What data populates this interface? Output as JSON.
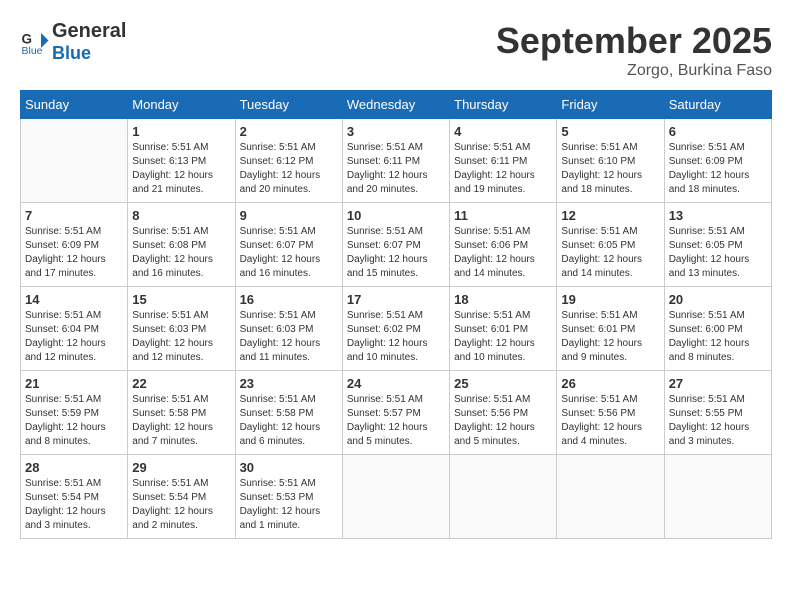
{
  "header": {
    "logo_line1": "General",
    "logo_line2": "Blue",
    "month": "September 2025",
    "location": "Zorgo, Burkina Faso"
  },
  "days_of_week": [
    "Sunday",
    "Monday",
    "Tuesday",
    "Wednesday",
    "Thursday",
    "Friday",
    "Saturday"
  ],
  "weeks": [
    [
      {
        "day": "",
        "info": ""
      },
      {
        "day": "1",
        "info": "Sunrise: 5:51 AM\nSunset: 6:13 PM\nDaylight: 12 hours\nand 21 minutes."
      },
      {
        "day": "2",
        "info": "Sunrise: 5:51 AM\nSunset: 6:12 PM\nDaylight: 12 hours\nand 20 minutes."
      },
      {
        "day": "3",
        "info": "Sunrise: 5:51 AM\nSunset: 6:11 PM\nDaylight: 12 hours\nand 20 minutes."
      },
      {
        "day": "4",
        "info": "Sunrise: 5:51 AM\nSunset: 6:11 PM\nDaylight: 12 hours\nand 19 minutes."
      },
      {
        "day": "5",
        "info": "Sunrise: 5:51 AM\nSunset: 6:10 PM\nDaylight: 12 hours\nand 18 minutes."
      },
      {
        "day": "6",
        "info": "Sunrise: 5:51 AM\nSunset: 6:09 PM\nDaylight: 12 hours\nand 18 minutes."
      }
    ],
    [
      {
        "day": "7",
        "info": "Sunrise: 5:51 AM\nSunset: 6:09 PM\nDaylight: 12 hours\nand 17 minutes."
      },
      {
        "day": "8",
        "info": "Sunrise: 5:51 AM\nSunset: 6:08 PM\nDaylight: 12 hours\nand 16 minutes."
      },
      {
        "day": "9",
        "info": "Sunrise: 5:51 AM\nSunset: 6:07 PM\nDaylight: 12 hours\nand 16 minutes."
      },
      {
        "day": "10",
        "info": "Sunrise: 5:51 AM\nSunset: 6:07 PM\nDaylight: 12 hours\nand 15 minutes."
      },
      {
        "day": "11",
        "info": "Sunrise: 5:51 AM\nSunset: 6:06 PM\nDaylight: 12 hours\nand 14 minutes."
      },
      {
        "day": "12",
        "info": "Sunrise: 5:51 AM\nSunset: 6:05 PM\nDaylight: 12 hours\nand 14 minutes."
      },
      {
        "day": "13",
        "info": "Sunrise: 5:51 AM\nSunset: 6:05 PM\nDaylight: 12 hours\nand 13 minutes."
      }
    ],
    [
      {
        "day": "14",
        "info": "Sunrise: 5:51 AM\nSunset: 6:04 PM\nDaylight: 12 hours\nand 12 minutes."
      },
      {
        "day": "15",
        "info": "Sunrise: 5:51 AM\nSunset: 6:03 PM\nDaylight: 12 hours\nand 12 minutes."
      },
      {
        "day": "16",
        "info": "Sunrise: 5:51 AM\nSunset: 6:03 PM\nDaylight: 12 hours\nand 11 minutes."
      },
      {
        "day": "17",
        "info": "Sunrise: 5:51 AM\nSunset: 6:02 PM\nDaylight: 12 hours\nand 10 minutes."
      },
      {
        "day": "18",
        "info": "Sunrise: 5:51 AM\nSunset: 6:01 PM\nDaylight: 12 hours\nand 10 minutes."
      },
      {
        "day": "19",
        "info": "Sunrise: 5:51 AM\nSunset: 6:01 PM\nDaylight: 12 hours\nand 9 minutes."
      },
      {
        "day": "20",
        "info": "Sunrise: 5:51 AM\nSunset: 6:00 PM\nDaylight: 12 hours\nand 8 minutes."
      }
    ],
    [
      {
        "day": "21",
        "info": "Sunrise: 5:51 AM\nSunset: 5:59 PM\nDaylight: 12 hours\nand 8 minutes."
      },
      {
        "day": "22",
        "info": "Sunrise: 5:51 AM\nSunset: 5:58 PM\nDaylight: 12 hours\nand 7 minutes."
      },
      {
        "day": "23",
        "info": "Sunrise: 5:51 AM\nSunset: 5:58 PM\nDaylight: 12 hours\nand 6 minutes."
      },
      {
        "day": "24",
        "info": "Sunrise: 5:51 AM\nSunset: 5:57 PM\nDaylight: 12 hours\nand 5 minutes."
      },
      {
        "day": "25",
        "info": "Sunrise: 5:51 AM\nSunset: 5:56 PM\nDaylight: 12 hours\nand 5 minutes."
      },
      {
        "day": "26",
        "info": "Sunrise: 5:51 AM\nSunset: 5:56 PM\nDaylight: 12 hours\nand 4 minutes."
      },
      {
        "day": "27",
        "info": "Sunrise: 5:51 AM\nSunset: 5:55 PM\nDaylight: 12 hours\nand 3 minutes."
      }
    ],
    [
      {
        "day": "28",
        "info": "Sunrise: 5:51 AM\nSunset: 5:54 PM\nDaylight: 12 hours\nand 3 minutes."
      },
      {
        "day": "29",
        "info": "Sunrise: 5:51 AM\nSunset: 5:54 PM\nDaylight: 12 hours\nand 2 minutes."
      },
      {
        "day": "30",
        "info": "Sunrise: 5:51 AM\nSunset: 5:53 PM\nDaylight: 12 hours\nand 1 minute."
      },
      {
        "day": "",
        "info": ""
      },
      {
        "day": "",
        "info": ""
      },
      {
        "day": "",
        "info": ""
      },
      {
        "day": "",
        "info": ""
      }
    ]
  ]
}
